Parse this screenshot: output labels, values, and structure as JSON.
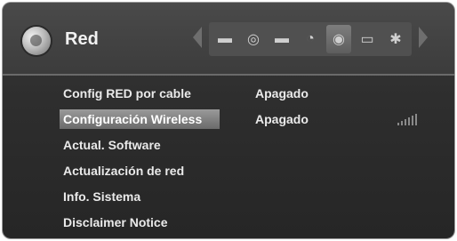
{
  "header": {
    "title": "Red",
    "tabs": [
      {
        "icon": "tv-icon",
        "glyph": "▬",
        "active": false
      },
      {
        "icon": "disc-icon",
        "glyph": "◎",
        "active": false
      },
      {
        "icon": "picture-icon",
        "glyph": "▬",
        "active": false
      },
      {
        "icon": "audio-settings-icon",
        "glyph": "◔",
        "active": false
      },
      {
        "icon": "network-globe-icon",
        "glyph": "◉",
        "active": true
      },
      {
        "icon": "lock-icon",
        "glyph": "▭",
        "active": false
      },
      {
        "icon": "gear-icon",
        "glyph": "✱",
        "active": false
      }
    ]
  },
  "menu": {
    "items": [
      {
        "label": "Config RED por cable",
        "value": "Apagado"
      },
      {
        "label": "Configuración Wireless",
        "value": "Apagado",
        "selected": true
      },
      {
        "label": "Actual. Software",
        "value": ""
      },
      {
        "label": "Actualización de red",
        "value": ""
      },
      {
        "label": "Info. Sistema",
        "value": ""
      },
      {
        "label": "Disclaimer Notice",
        "value": ""
      }
    ]
  },
  "colors": {
    "background": "#2e2e2e",
    "highlight": "#8a8a8a",
    "text": "#eaeaea"
  }
}
